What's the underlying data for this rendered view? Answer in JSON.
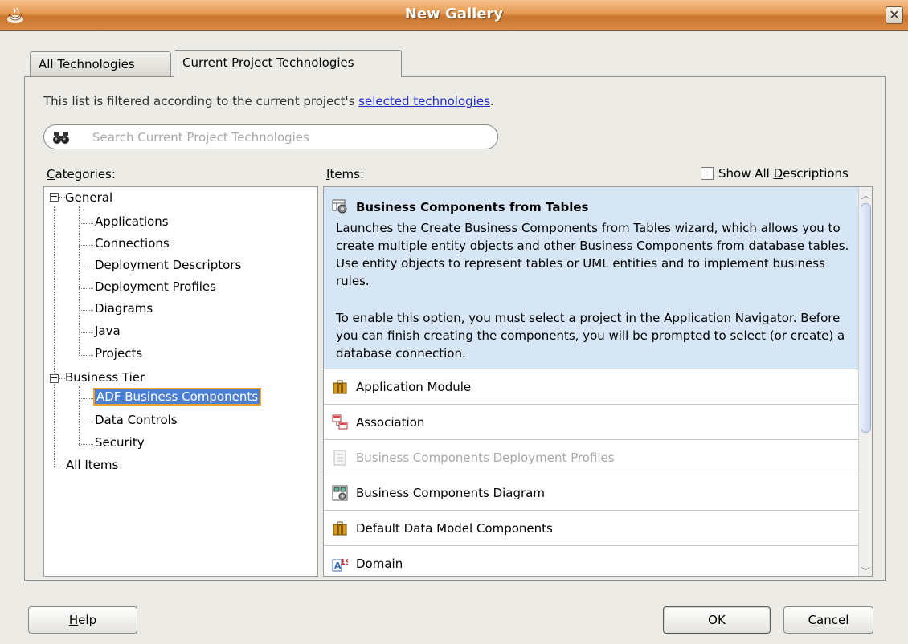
{
  "window": {
    "title": "New Gallery",
    "close_glyph": "✕"
  },
  "tabs": [
    {
      "label": "All Technologies",
      "active": false
    },
    {
      "label": "Current Project Technologies",
      "active": true
    }
  ],
  "filter": {
    "prefix": "This list is filtered according to the current project's ",
    "link": "selected technologies",
    "suffix": "."
  },
  "search": {
    "placeholder": "Search Current Project Technologies"
  },
  "categories": {
    "header_first": "C",
    "header_rest": "ategories:",
    "nodes": [
      {
        "label": "General",
        "level": 0,
        "expanded": true
      },
      {
        "label": "Applications",
        "level": 1
      },
      {
        "label": "Connections",
        "level": 1
      },
      {
        "label": "Deployment Descriptors",
        "level": 1
      },
      {
        "label": "Deployment Profiles",
        "level": 1
      },
      {
        "label": "Diagrams",
        "level": 1
      },
      {
        "label": "Java",
        "level": 1
      },
      {
        "label": "Projects",
        "level": 1
      },
      {
        "label": "Business Tier",
        "level": 0,
        "expanded": true
      },
      {
        "label": "ADF Business Components",
        "level": 1,
        "selected": true
      },
      {
        "label": "Data Controls",
        "level": 1
      },
      {
        "label": "Security",
        "level": 1
      },
      {
        "label": "All Items",
        "level": 0
      }
    ]
  },
  "items": {
    "header_first": "I",
    "header_rest": "tems:",
    "show_all_prefix": "Show All ",
    "show_all_ul": "D",
    "show_all_rest": "escriptions",
    "show_all_checked": false,
    "selected": {
      "title": "Business Components from Tables",
      "desc1": "Launches the Create Business Components from Tables wizard, which allows you to create multiple entity objects and other Business Components from database tables.  Use entity objects to represent tables or UML entities and to implement business rules.",
      "desc2": "To enable this option, you must select a project in the Application Navigator. Before you can finish creating the components, you will be prompted to select (or create) a database connection.",
      "icon": "bc-tables-icon"
    },
    "rows": [
      {
        "label": "Application Module",
        "icon": "application-module-icon",
        "enabled": true
      },
      {
        "label": "Association",
        "icon": "association-icon",
        "enabled": true
      },
      {
        "label": "Business Components Deployment Profiles",
        "icon": "deployment-profile-icon",
        "enabled": false
      },
      {
        "label": "Business Components Diagram",
        "icon": "diagram-icon",
        "enabled": true
      },
      {
        "label": "Default Data Model Components",
        "icon": "data-model-icon",
        "enabled": true
      },
      {
        "label": "Domain",
        "icon": "domain-icon",
        "enabled": true
      }
    ]
  },
  "buttons": {
    "help_ul": "H",
    "help_rest": "elp",
    "ok": "OK",
    "cancel": "Cancel"
  },
  "colors": {
    "titlebar": "#e39a52",
    "selection": "#4a7fd1",
    "selected_item_bg": "#d6e6f5",
    "link": "#1c2ec8"
  }
}
